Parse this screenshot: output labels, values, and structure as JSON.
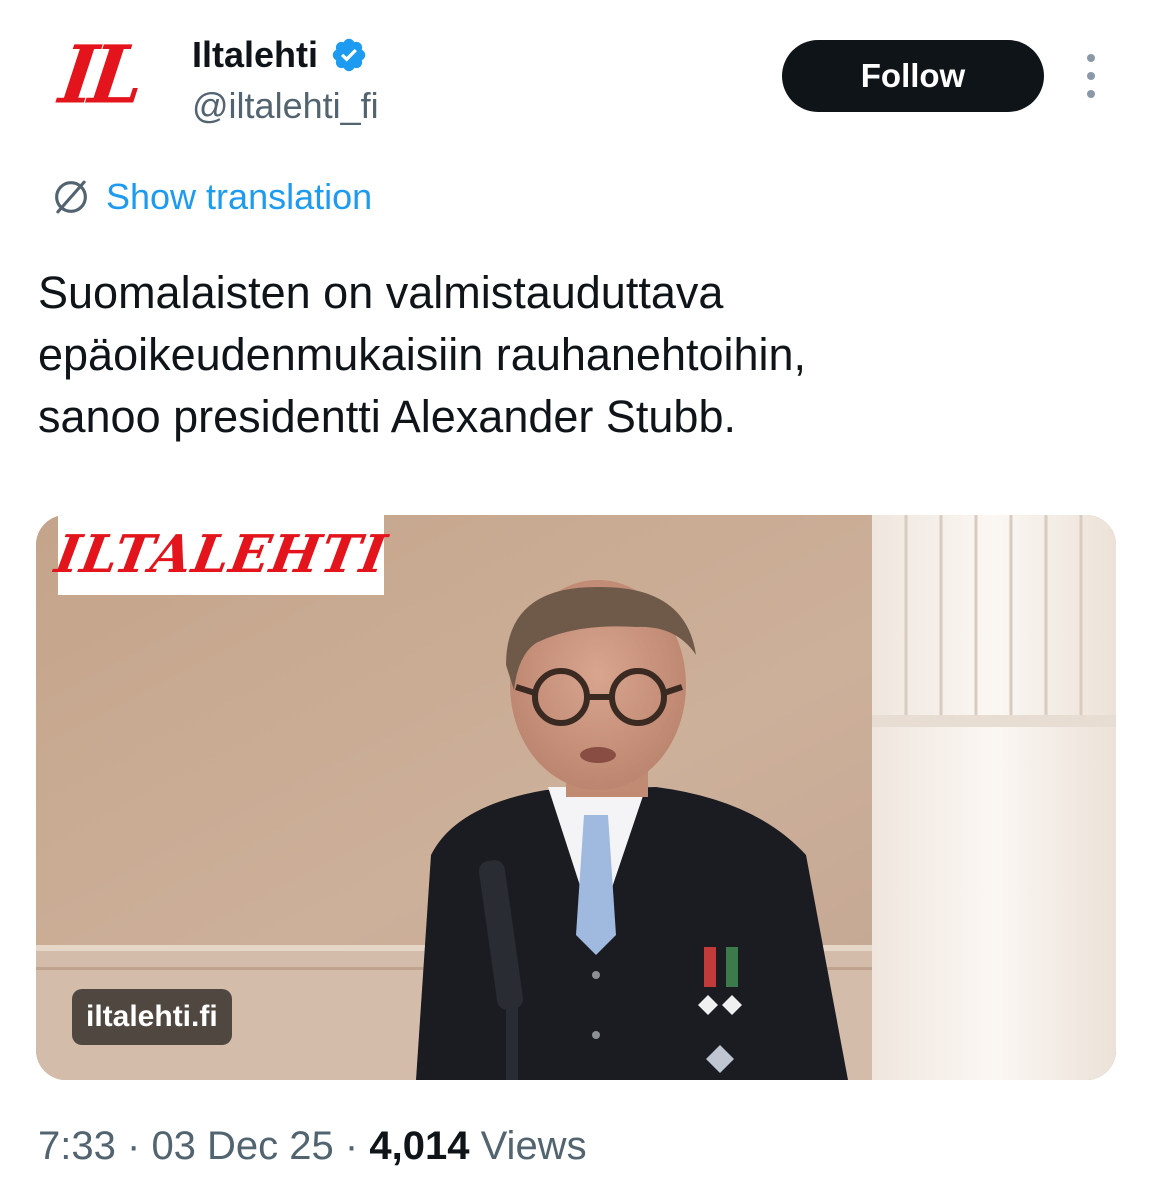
{
  "account": {
    "avatar_text": "IL",
    "display_name": "Iltalehti",
    "handle": "@iltalehti_fi",
    "verified": true
  },
  "actions": {
    "follow_label": "Follow"
  },
  "translation": {
    "label": "Show translation"
  },
  "tweet": {
    "lines": [
      "Suomalaisten on valmistauduttava",
      "epäoikeudenmukaisiin rauhanehtoihin,",
      "sanoo presidentti Alexander Stubb."
    ]
  },
  "media": {
    "brand_text": "ILTALEHTI",
    "domain": "iltalehti.fi"
  },
  "meta": {
    "time": "7:33",
    "separator": "·",
    "date": "03 Dec 25",
    "views_count": "4,014",
    "views_label": "Views"
  },
  "colors": {
    "accent": "#1d9bf0",
    "brand_red": "#e4141c",
    "text_primary": "#0f1419",
    "text_secondary": "#536471",
    "follow_bg": "#0f1419"
  },
  "icons": {
    "verified": "verified-badge-icon",
    "more": "more-options-icon",
    "translation": "globe-icon"
  }
}
